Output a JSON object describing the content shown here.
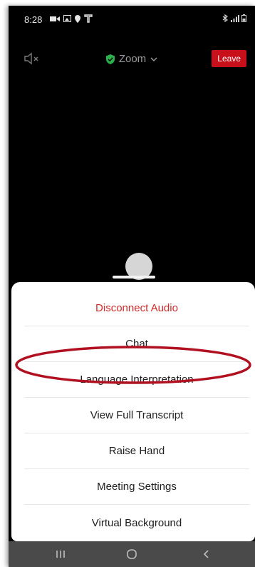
{
  "status_bar": {
    "time": "8:28",
    "left_icons": [
      "video-icon",
      "image-icon",
      "location-icon",
      "carrier-icon"
    ],
    "right_icons": [
      "bluetooth-icon",
      "signal-icon",
      "battery-icon"
    ]
  },
  "meeting": {
    "title": "Zoom",
    "leave_label": "Leave",
    "speaker_state": "speaker-muted-icon",
    "shield_color": "#2bb24c",
    "leave_color": "#c8101a"
  },
  "menu": {
    "items": [
      {
        "label": "Disconnect Audio",
        "style": "danger"
      },
      {
        "label": "Chat",
        "style": "normal"
      },
      {
        "label": "Language Interpretation",
        "style": "normal",
        "highlighted": true
      },
      {
        "label": "View Full Transcript",
        "style": "normal"
      },
      {
        "label": "Raise Hand",
        "style": "normal"
      },
      {
        "label": "Meeting Settings",
        "style": "normal"
      },
      {
        "label": "Virtual Background",
        "style": "normal"
      }
    ],
    "highlight_color": "#b01020",
    "danger_color": "#d42a2a"
  },
  "nav_bar": {
    "buttons": [
      "recent-apps-icon",
      "home-icon",
      "back-icon"
    ]
  }
}
